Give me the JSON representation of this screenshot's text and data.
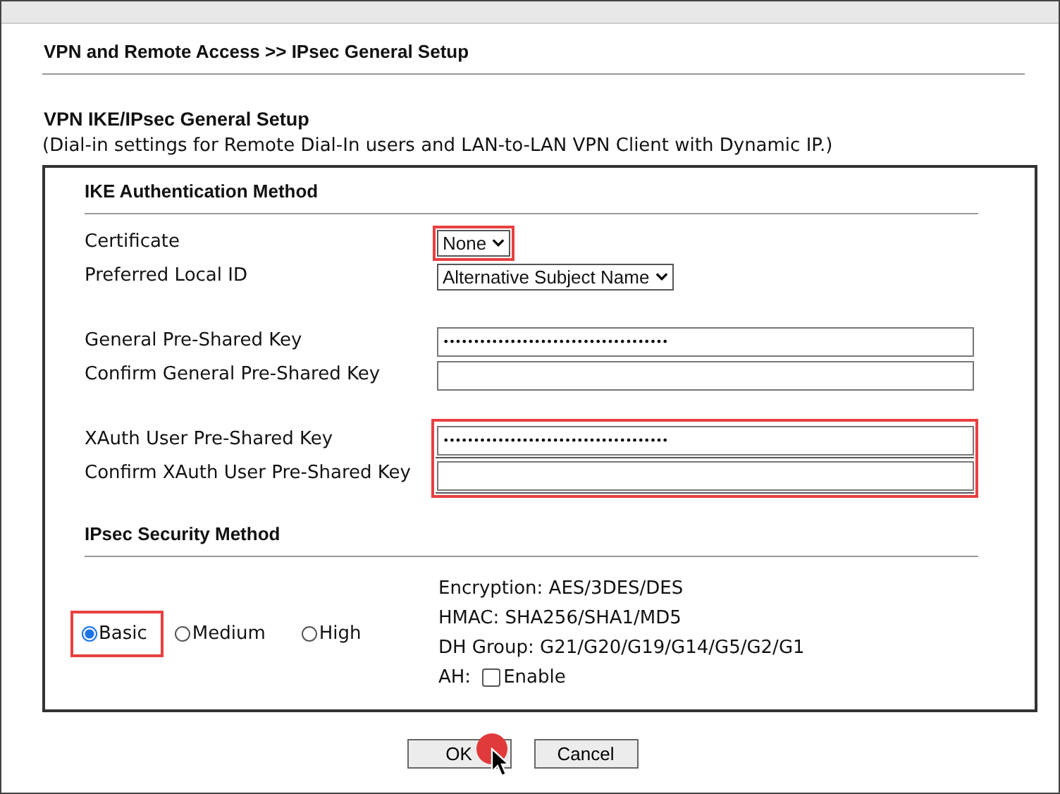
{
  "breadcrumb": "VPN and Remote Access >> IPsec General Setup",
  "section": {
    "title": "VPN IKE/IPsec General Setup",
    "subtitle": "(Dial-in settings for Remote Dial-In users and LAN-to-LAN VPN Client with Dynamic IP.)"
  },
  "ike": {
    "title": "IKE Authentication Method",
    "groups": [
      {
        "highlighted": false,
        "rows": [
          {
            "kind": "select",
            "label": "Certificate",
            "value": "None",
            "highlighted": true
          },
          {
            "kind": "select",
            "label": "Preferred Local ID",
            "value": "Alternative Subject Name",
            "highlighted": false
          }
        ]
      },
      {
        "highlighted": false,
        "rows": [
          {
            "kind": "text",
            "label": "General Pre-Shared Key",
            "value": "•••••••••••••••••••••••••••••••••••••"
          },
          {
            "kind": "text",
            "label": "Confirm General Pre-Shared Key"
          }
        ]
      },
      {
        "highlighted": true,
        "rows": [
          {
            "kind": "text",
            "label": "XAuth User Pre-Shared Key",
            "value": "•••••••••••••••••••••••••••••••••••••"
          },
          {
            "kind": "text",
            "label": "Confirm XAuth User Pre-Shared Key"
          }
        ]
      }
    ]
  },
  "ipsec": {
    "title": "IPsec Security Method",
    "methods": [
      {
        "label": "Basic",
        "selected": true,
        "highlighted": true
      },
      {
        "label": "Medium",
        "selected": false,
        "highlighted": false
      },
      {
        "label": "High",
        "selected": false,
        "highlighted": false
      }
    ],
    "details": [
      "Encryption: AES/3DES/DES",
      "HMAC: SHA256/SHA1/MD5",
      "DH Group: G21/G20/G19/G14/G5/G2/G1"
    ],
    "ah": {
      "label": "AH:",
      "option": "Enable",
      "checked": false
    }
  },
  "buttons": [
    {
      "label": "OK",
      "clicked": true
    },
    {
      "label": "Cancel",
      "clicked": false
    }
  ]
}
